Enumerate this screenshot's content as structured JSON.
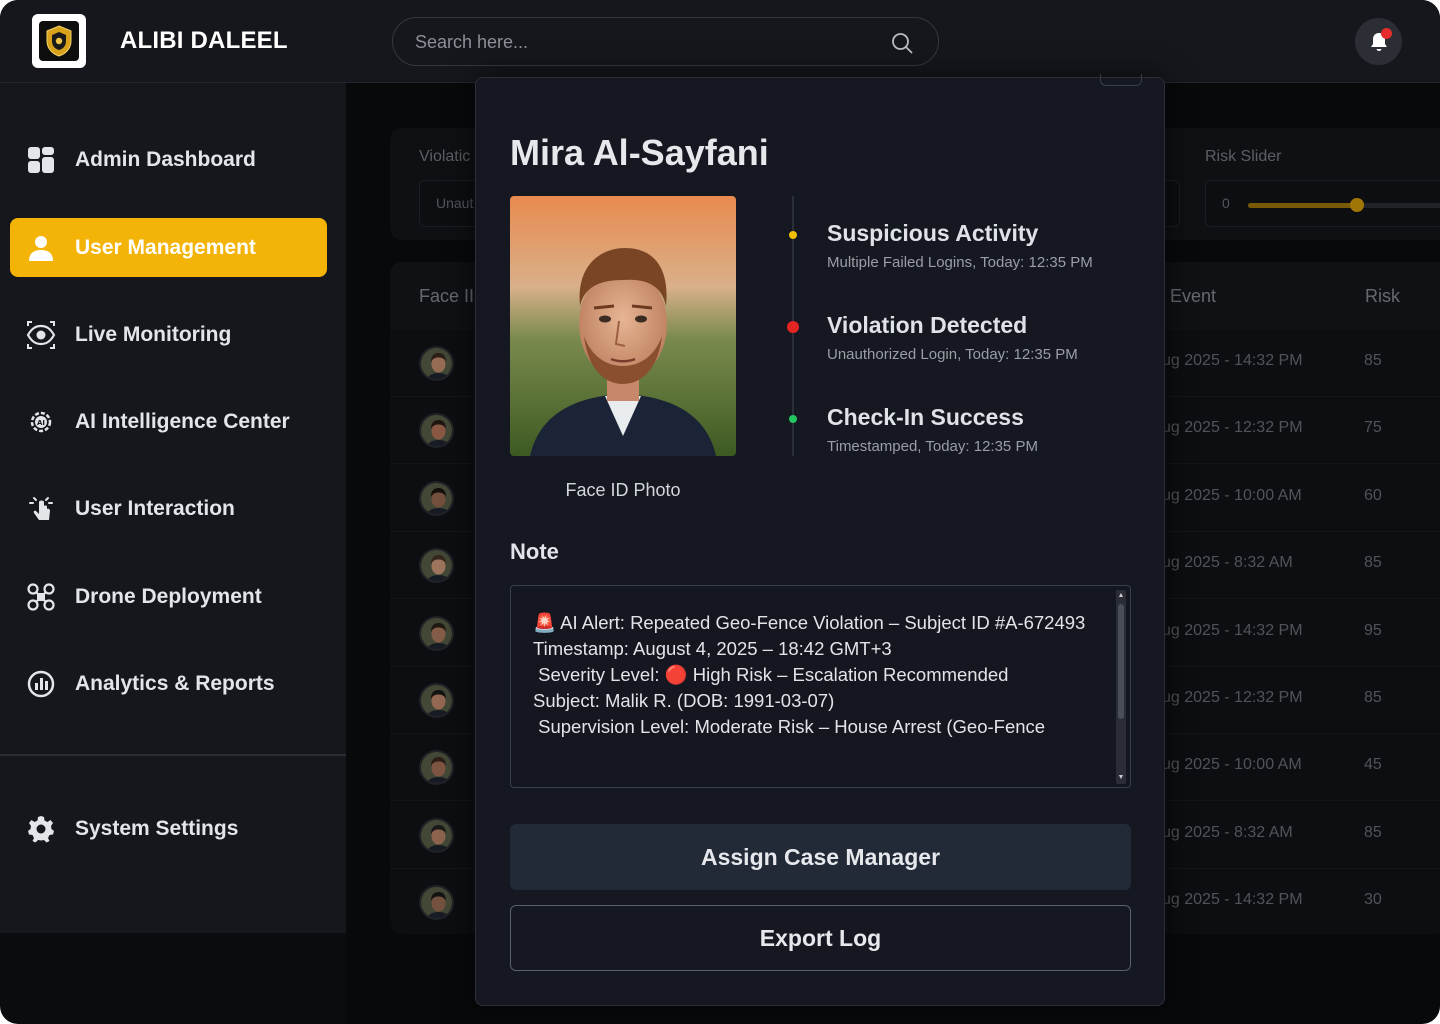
{
  "app": {
    "brand": "ALIBI DALEEL",
    "logo_text": "Alibi Daleel"
  },
  "search": {
    "placeholder": "Search here..."
  },
  "sidebar": {
    "items": [
      {
        "label": "Admin Dashboard",
        "icon": "dashboard-icon"
      },
      {
        "label": "User Management",
        "icon": "user-icon",
        "active": true
      },
      {
        "label": "Live Monitoring",
        "icon": "eye-icon"
      },
      {
        "label": "AI Intelligence Center",
        "icon": "ai-gear-icon"
      },
      {
        "label": "User Interaction",
        "icon": "touch-icon"
      },
      {
        "label": "Drone Deployment",
        "icon": "drone-icon"
      },
      {
        "label": "Analytics & Reports",
        "icon": "analytics-icon"
      }
    ],
    "settings": {
      "label": "System Settings",
      "icon": "gear-icon"
    }
  },
  "background": {
    "filters": {
      "violation_label": "Violatic",
      "violation_value": "Unaut",
      "risk_label": "Risk Slider",
      "risk_value": "0"
    },
    "table": {
      "headers": {
        "face": "Face II",
        "event": "Event",
        "risk": "Risk"
      },
      "rows": [
        {
          "event": "ug 2025 - 14:32 PM",
          "risk": "85"
        },
        {
          "event": "ug 2025 - 12:32 PM",
          "risk": "75"
        },
        {
          "event": "ug 2025 - 10:00 AM",
          "risk": "60"
        },
        {
          "event": "ug 2025 - 8:32 AM",
          "risk": "85"
        },
        {
          "event": "ug 2025 - 14:32 PM",
          "risk": "95"
        },
        {
          "event": "ug 2025 - 12:32 PM",
          "risk": "85"
        },
        {
          "event": "ug 2025 - 10:00 AM",
          "risk": "45"
        },
        {
          "event": "ug 2025 - 8:32 AM",
          "risk": "85"
        },
        {
          "event": "ug 2025 - 14:32 PM",
          "risk": "30"
        }
      ]
    }
  },
  "modal": {
    "title": "Mira Al-Sayfani",
    "photo_caption": "Face ID Photo",
    "timeline": [
      {
        "title": "Suspicious Activity",
        "subtitle": "Multiple Failed Logins, Today: 12:35 PM",
        "color": "#f3c000"
      },
      {
        "title": "Violation Detected",
        "subtitle": "Unauthorized Login, Today: 12:35 PM",
        "color": "#e52424"
      },
      {
        "title": "Check-In Success",
        "subtitle": "Timestamped, Today: 12:35 PM",
        "color": "#22c55e"
      }
    ],
    "note_label": "Note",
    "note_text": "🚨 AI Alert: Repeated Geo-Fence Violation – Subject ID #A-672493\nTimestamp: August 4, 2025 – 18:42 GMT+3\n Severity Level: 🔴 High Risk – Escalation Recommended\nSubject: Malik R. (DOB: 1991-03-07)\n Supervision Level: Moderate Risk – House Arrest (Geo-Fence",
    "assign_button": "Assign Case Manager",
    "export_button": "Export Log"
  },
  "colors": {
    "accent": "#f3b307",
    "background": "#0b0c0f",
    "panel": "#151820",
    "notification": "#e52d2d"
  }
}
